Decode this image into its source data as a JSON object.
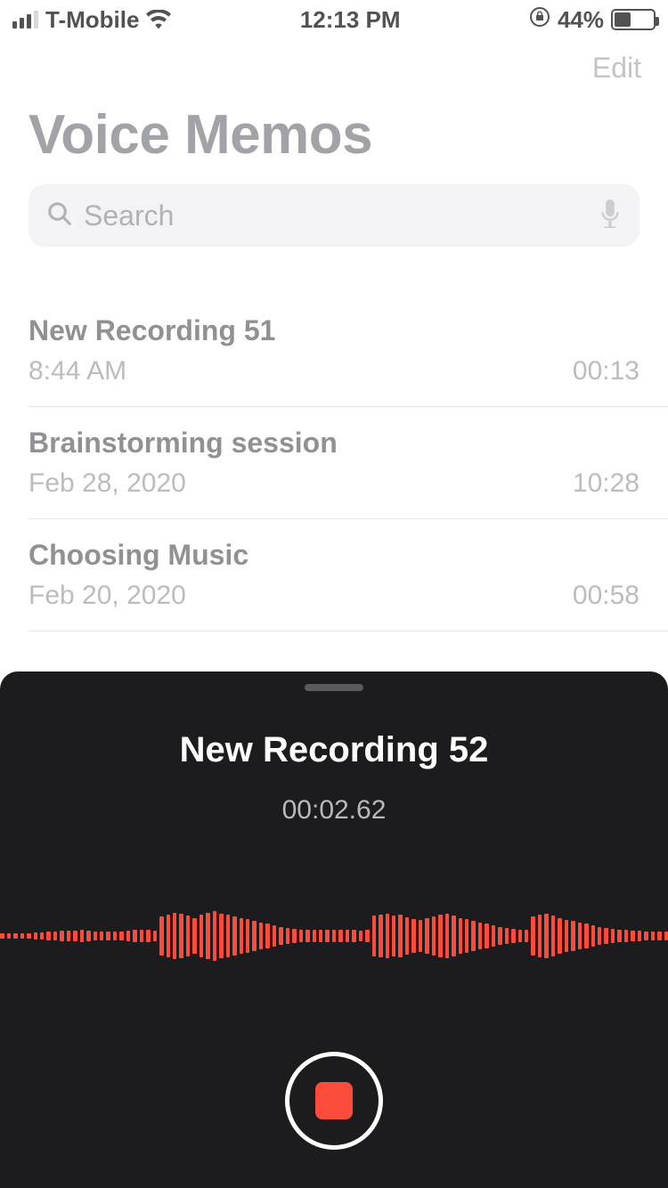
{
  "status": {
    "carrier": "T-Mobile",
    "time": "12:13 PM",
    "battery_percent_text": "44%",
    "battery_level_pct": 44
  },
  "nav": {
    "edit_label": "Edit"
  },
  "header": {
    "title": "Voice Memos"
  },
  "search": {
    "placeholder": "Search"
  },
  "recordings": [
    {
      "title": "New Recording 51",
      "date": "8:44 AM",
      "duration": "00:13"
    },
    {
      "title": "Brainstorming session",
      "date": "Feb 28, 2020",
      "duration": "10:28"
    },
    {
      "title": "Choosing Music",
      "date": "Feb 20, 2020",
      "duration": "00:58"
    }
  ],
  "recording_sheet": {
    "title": "New Recording 52",
    "elapsed": "00:02.62",
    "accent_color": "#fc4a3b",
    "waveform_heights": [
      6,
      6,
      6,
      6,
      6,
      8,
      8,
      10,
      10,
      12,
      12,
      12,
      14,
      12,
      10,
      10,
      10,
      10,
      10,
      12,
      14,
      14,
      14,
      12,
      44,
      48,
      52,
      50,
      46,
      40,
      48,
      52,
      56,
      50,
      48,
      44,
      40,
      38,
      34,
      30,
      28,
      24,
      20,
      18,
      16,
      14,
      14,
      14,
      14,
      14,
      14,
      14,
      14,
      14,
      12,
      14,
      46,
      48,
      50,
      46,
      48,
      42,
      38,
      36,
      40,
      44,
      48,
      50,
      46,
      40,
      38,
      34,
      30,
      28,
      24,
      20,
      18,
      16,
      14,
      14,
      44,
      48,
      50,
      46,
      40,
      36,
      34,
      30,
      28,
      24,
      20,
      18,
      16,
      14,
      14,
      12,
      12,
      10,
      10,
      10,
      10
    ]
  }
}
